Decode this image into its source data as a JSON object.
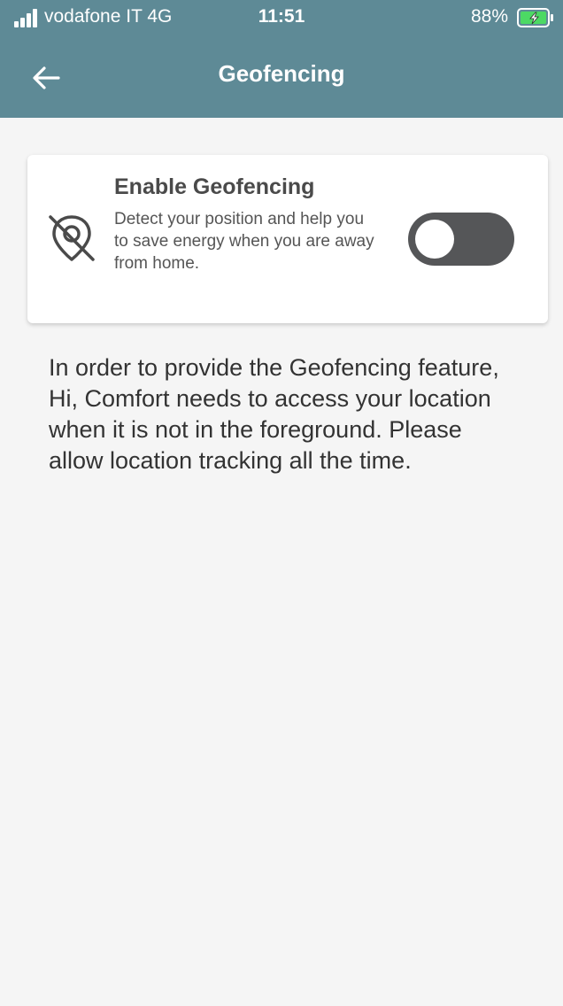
{
  "status_bar": {
    "carrier": "vodafone IT  4G",
    "time": "11:51",
    "battery": "88%",
    "signal_icon": "signal-bars-icon",
    "battery_icon": "battery-charging-icon"
  },
  "header": {
    "title": "Geofencing",
    "back_icon": "arrow-left-icon",
    "background_color": "#5e8a96"
  },
  "card": {
    "icon": "location-off-icon",
    "title": "Enable Geofencing",
    "description": "Detect your position and help you to save energy when you are away from home.",
    "toggle_on": false,
    "toggle_color": "#555658"
  },
  "info_text": "In order to provide the Geofencing feature, Hi, Comfort needs to access your location when it is not in the foreground. Please allow location tracking all the time."
}
